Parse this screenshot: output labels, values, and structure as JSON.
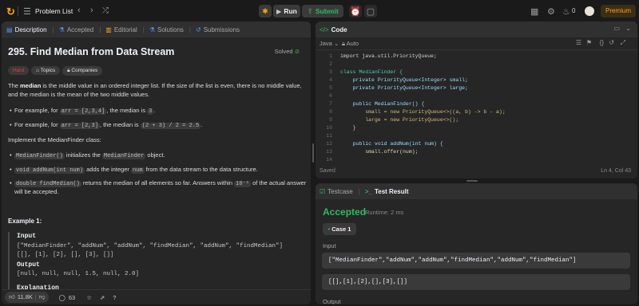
{
  "topbar": {
    "problem_list": "Problem List",
    "run": "Run",
    "submit": "Submit",
    "streak": "0",
    "premium": "Premium"
  },
  "left_tabs": [
    "Description",
    "Accepted",
    "Editorial",
    "Solutions",
    "Submissions"
  ],
  "problem": {
    "title": "295. Find Median from Data Stream",
    "status": "Solved",
    "difficulty": "Hard",
    "topics": "Topics",
    "companies": "Companies",
    "intro_1a": "The ",
    "intro_1b": "median",
    "intro_1c": " is the middle value in an ordered integer list. If the size of the list is even, there is no middle value,",
    "intro_2": "and the median is the mean of the two middle values.",
    "ex1_a": "For example, for ",
    "ex1_code": "arr = [2,3,4]",
    "ex1_b": ", the median is ",
    "ex1_val": "3",
    "ex1_c": ".",
    "ex2_a": "For example, for ",
    "ex2_code": "arr = [2,3]",
    "ex2_b": ", the median is ",
    "ex2_val": "(2 + 3) / 2 = 2.5",
    "ex2_c": ".",
    "implement": "Implement the MedianFinder class:",
    "b1_code": "MedianFinder()",
    "b1_a": " initializes the ",
    "b1_code2": "MedianFinder",
    "b1_b": " object.",
    "b2_code": "void addNum(int num)",
    "b2_a": " adds the integer ",
    "b2_code2": "num",
    "b2_b": " from the data stream to the data structure.",
    "b3_code": "double findMedian()",
    "b3_a": " returns the median of all elements so far. Answers within ",
    "b3_code2": "10⁻⁵",
    "b3_b": " of the actual answer",
    "b3_line2": "will be accepted.",
    "example_title": "Example 1:",
    "input_label": "Input",
    "input_1": "[\"MedianFinder\", \"addNum\", \"addNum\", \"findMedian\", \"addNum\", \"findMedian\"]",
    "input_2": "[[], [1], [2], [], [3], []]",
    "output_label": "Output",
    "output_1": "[null, null, null, 1.5, null, 2.0]",
    "explanation_label": "Explanation"
  },
  "bottom_bar": {
    "likes": "11.8K",
    "comments": "63"
  },
  "code_panel": {
    "title": "Code",
    "language": "Java",
    "auto": "Auto",
    "saved": "Saved",
    "cursor": "Ln 4, Col 43",
    "lines": [
      {
        "n": "1",
        "t": "import java.util.PriorityQueue;"
      },
      {
        "n": "2",
        "t": ""
      },
      {
        "n": "3",
        "t": "class MedianFinder {"
      },
      {
        "n": "4",
        "t": "    private PriorityQueue<Integer> small;"
      },
      {
        "n": "5",
        "t": "    private PriorityQueue<Integer> large;"
      },
      {
        "n": "6",
        "t": ""
      },
      {
        "n": "7",
        "t": "    public MedianFinder() {"
      },
      {
        "n": "8",
        "t": "        small = new PriorityQueue<>((a, b) -> b - a);"
      },
      {
        "n": "9",
        "t": "        large = new PriorityQueue<>();"
      },
      {
        "n": "10",
        "t": "    }"
      },
      {
        "n": "11",
        "t": ""
      },
      {
        "n": "12",
        "t": "    public void addNum(int num) {"
      },
      {
        "n": "13",
        "t": "        small.offer(num);"
      },
      {
        "n": "14",
        "t": ""
      }
    ]
  },
  "result_panel": {
    "tab_testcase": "Testcase",
    "tab_result": "Test Result",
    "verdict": "Accepted",
    "runtime": "Runtime: 2 ms",
    "case": "Case 1",
    "input_label": "Input",
    "input_1": "[\"MedianFinder\",\"addNum\",\"addNum\",\"findMedian\",\"addNum\",\"findMedian\"]",
    "input_2": "[[],[1],[2],[],[3],[]]",
    "output_label": "Output"
  },
  "colors": {
    "accent_green": "#2cbb5d",
    "hard": "#f63737",
    "premium": "#ffa116"
  }
}
